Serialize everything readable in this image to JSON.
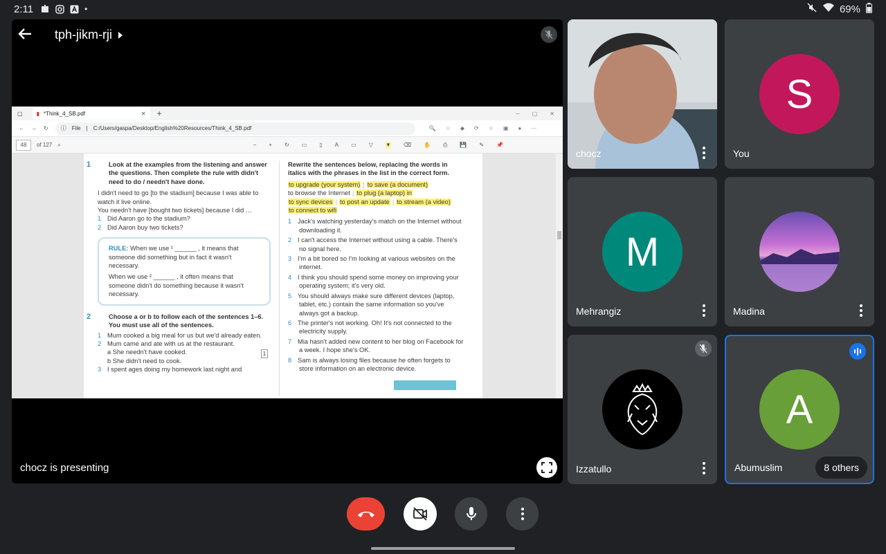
{
  "status_bar": {
    "time": "2:11",
    "battery": "69%"
  },
  "meeting": {
    "code": "tph-jikm-rji",
    "presenting_label": "chocz is presenting"
  },
  "shared_screen": {
    "tab_title": "*Think_4_SB.pdf",
    "url_prefix": "File",
    "url": "C:/Users/gaspa/Desktop/English%20Resources/Think_4_SB.pdf",
    "page_number": "48",
    "page_total": "of 127",
    "left": {
      "ex1_num": "1",
      "ex1_title": "Look at the examples from the listening and answer the questions. Then complete the rule with didn't need to do / needn't have done.",
      "ex1_line1": "I didn't need to go [to the stadium] because I was able to watch it live online.",
      "ex1_line2": "You needn't have [bought two tickets] because I did …",
      "ex1_q1_num": "1",
      "ex1_q1": "Did Aaron go to the stadium?",
      "ex1_q2_num": "2",
      "ex1_q2": "Did Aaron buy two tickets?",
      "rule_label": "RULE:",
      "rule_1": "When we use ¹ ______ , it means that someone did something but in fact it wasn't necessary.",
      "rule_2": "When we use ² ______ , it often means that someone didn't do something because it wasn't necessary.",
      "ex2_num": "2",
      "ex2_title": "Choose a or b to follow each of the sentences 1–6. You must use all of the sentences.",
      "ex2_i1_num": "1",
      "ex2_i1": "Mum cooked a big meal for us but we'd already eaten.",
      "ex2_i2_num": "2",
      "ex2_i2": "Mum came and ate with us at the restaurant.",
      "ex2_a": "a   She needn't have cooked.",
      "ex2_b": "b   She didn't need to cook.",
      "ex2_answer": "1",
      "ex2_i3_num": "3",
      "ex2_i3": "I spent ages doing my homework last night and"
    },
    "right": {
      "title": "Rewrite the sentences below, replacing the words in italics with the phrases in the list in the correct form.",
      "phrases": [
        "to upgrade (your system)",
        "to save (a document)",
        "to browse the Internet",
        "to plug (a laptop) in",
        "to sync devices",
        "to post an update",
        "to stream (a video)",
        "to connect to wifi"
      ],
      "items": [
        {
          "n": "1",
          "text": "Jack's watching yesterday's match on the Internet without downloading it."
        },
        {
          "n": "2",
          "text": "I can't access the Internet without using a cable. There's no signal here."
        },
        {
          "n": "3",
          "text": "I'm a bit bored so I'm looking at various websites on the internet."
        },
        {
          "n": "4",
          "text": "I think you should spend some money on improving your operating system; it's very old."
        },
        {
          "n": "5",
          "text": "You should always make sure different devices (laptop, tablet, etc.) contain the same information so you've always got a backup."
        },
        {
          "n": "6",
          "text": "The printer's not working. Oh! It's not connected to the electricity supply."
        },
        {
          "n": "7",
          "text": "Mia hasn't added new content to her blog on Facebook for a week. I hope she's OK."
        },
        {
          "n": "8",
          "text": "Sam is always losing files because he often forgets to store information on an electronic device."
        }
      ]
    }
  },
  "participants": [
    {
      "name": "chocz",
      "type": "video"
    },
    {
      "name": "You",
      "initial": "S",
      "color": "#c2185b"
    },
    {
      "name": "Mehrangiz",
      "initial": "M",
      "color": "#00897b"
    },
    {
      "name": "Madina",
      "type": "image"
    },
    {
      "name": "Izzatullo",
      "type": "logo",
      "muted": true
    },
    {
      "name": "Abumuslim",
      "initial": "A",
      "color": "#689f38",
      "speaking": true
    }
  ],
  "others_label": "8 others",
  "colors": {
    "end_call": "#ea4335",
    "active_border": "#1a73e8",
    "tile_bg": "#3c4043"
  },
  "icons": [
    "back-arrow-icon",
    "chevron-right-icon",
    "mic-off-icon",
    "fullscreen-icon",
    "switch-camera-icon",
    "volume-icon",
    "end-call-icon",
    "camera-off-icon",
    "mic-icon",
    "more-vert-icon"
  ]
}
